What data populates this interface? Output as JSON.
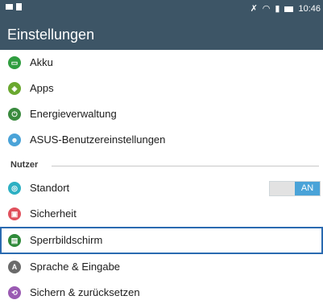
{
  "statusbar": {
    "time": "10:46",
    "icons": [
      "notification-icon",
      "image-icon",
      "mute-icon",
      "wifi-icon",
      "signal-icon",
      "battery-icon"
    ]
  },
  "appbar": {
    "title": "Einstellungen"
  },
  "items": [
    {
      "label": "Akku",
      "icon": "battery-icon",
      "color": "#2f9d3f"
    },
    {
      "label": "Apps",
      "icon": "apps-icon",
      "color": "#6aa82f"
    },
    {
      "label": "Energieverwaltung",
      "icon": "power-management-icon",
      "color": "#3a8a3e"
    },
    {
      "label": "ASUS-Benutzereinstellungen",
      "icon": "user-settings-icon",
      "color": "#4aa3d8"
    }
  ],
  "section": {
    "label": "Nutzer"
  },
  "items2": [
    {
      "label": "Standort",
      "icon": "location-icon",
      "color": "#2db0c3",
      "toggle": "AN"
    },
    {
      "label": "Sicherheit",
      "icon": "lock-icon",
      "color": "#e0505c"
    },
    {
      "label": "Sperrbildschirm",
      "icon": "lockscreen-icon",
      "color": "#2f8a3a",
      "selected": true
    },
    {
      "label": "Sprache & Eingabe",
      "icon": "language-icon",
      "color": "#6a6a6a"
    },
    {
      "label": "Sichern & zurücksetzen",
      "icon": "backup-icon",
      "color": "#9a5ab2"
    }
  ],
  "colors": {
    "appbar": "#3d5566",
    "accent": "#4aa3d8",
    "selection_border": "#2a6ab0"
  }
}
